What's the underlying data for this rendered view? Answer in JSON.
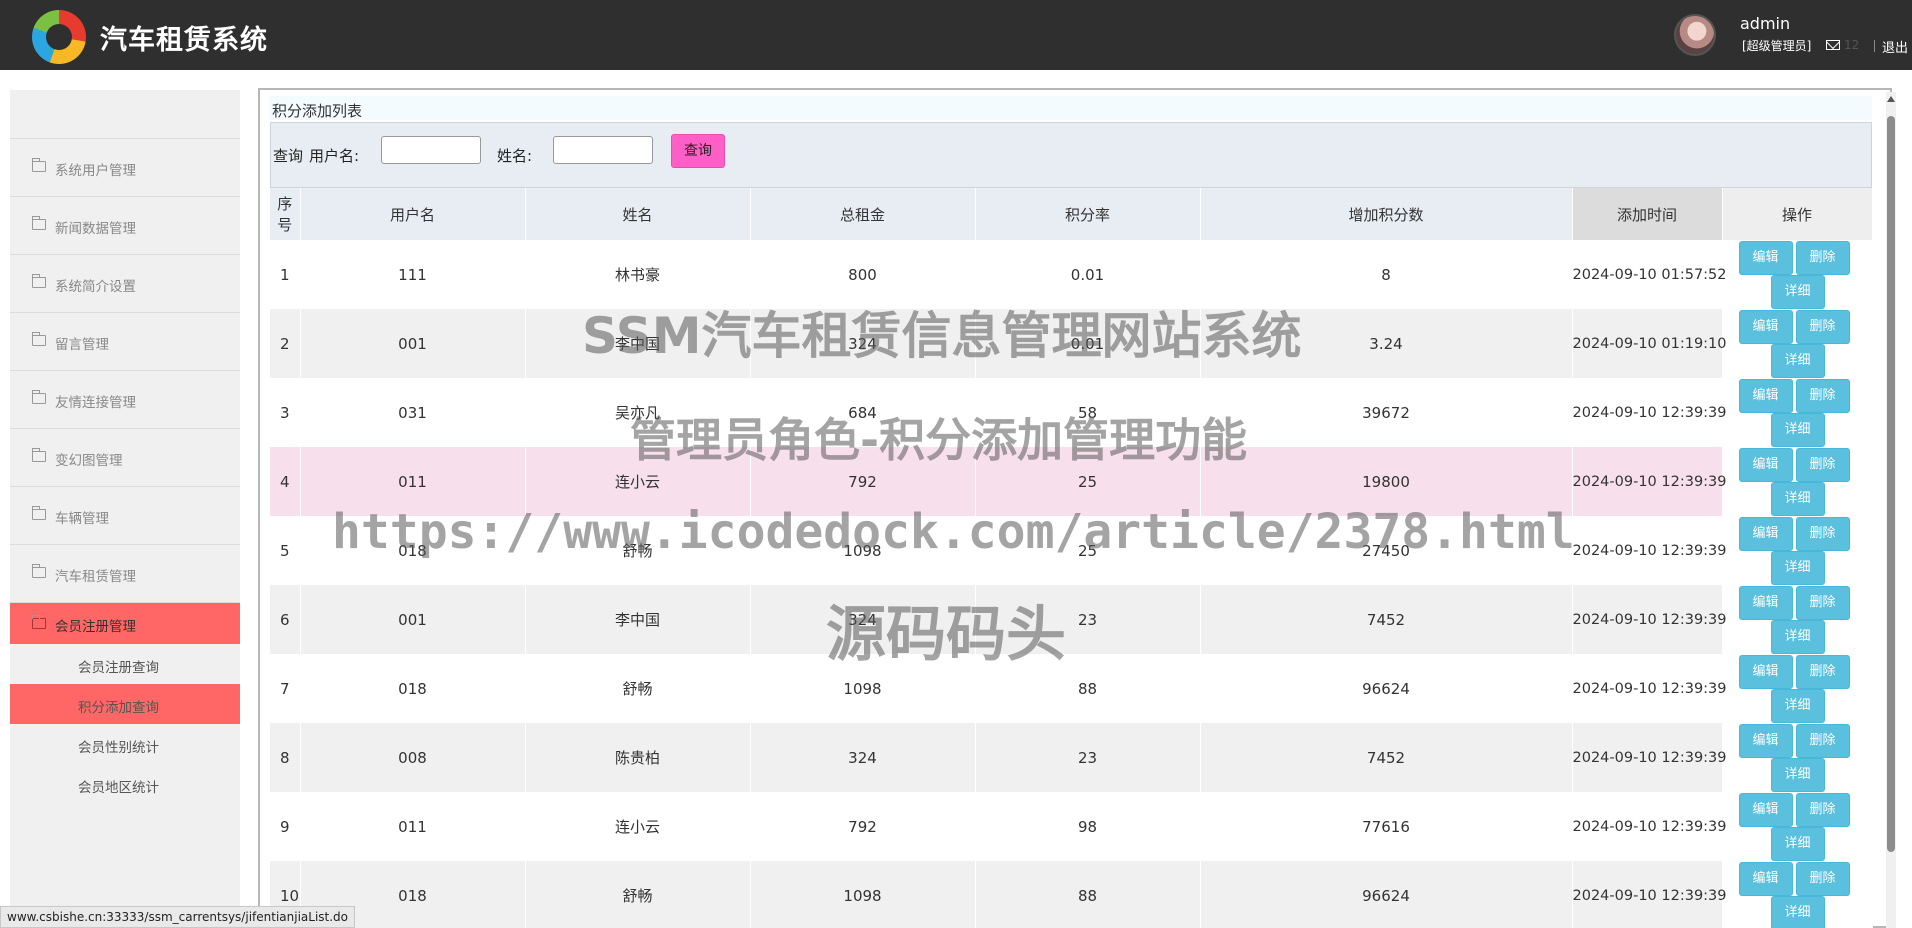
{
  "header": {
    "app_title": "汽车租赁系统",
    "user_name": "admin",
    "user_role": "[超级管理员]",
    "mail_count": "12",
    "logout": "退出"
  },
  "sidebar": {
    "items": [
      {
        "label": "系统用户管理"
      },
      {
        "label": "新闻数据管理"
      },
      {
        "label": "系统简介设置"
      },
      {
        "label": "留言管理"
      },
      {
        "label": "友情连接管理"
      },
      {
        "label": "变幻图管理"
      },
      {
        "label": "车辆管理"
      },
      {
        "label": "汽车租赁管理"
      },
      {
        "label": "会员注册管理"
      }
    ],
    "sub_items": [
      {
        "label": "会员注册查询"
      },
      {
        "label": "积分添加查询"
      },
      {
        "label": "会员性别统计"
      },
      {
        "label": "会员地区统计"
      }
    ]
  },
  "panel": {
    "title": "积分添加列表",
    "search": {
      "label_query": "查询",
      "label_username": "用户名:",
      "label_name": "姓名:",
      "username_value": "",
      "name_value": "",
      "button": "查询"
    }
  },
  "table": {
    "headers": [
      "序号",
      "用户名",
      "姓名",
      "总租金",
      "积分率",
      "增加积分数",
      "添加时间",
      "操作"
    ],
    "ops": {
      "edit": "编辑",
      "delete": "删除",
      "detail": "详细"
    },
    "rows": [
      {
        "idx": "1",
        "username": "111",
        "name": "林书豪",
        "rent": "800",
        "rate": "0.01",
        "points": "8",
        "time": "2024-09-10 01:57:52"
      },
      {
        "idx": "2",
        "username": "001",
        "name": "李中国",
        "rent": "324",
        "rate": "0.01",
        "points": "3.24",
        "time": "2024-09-10 01:19:10"
      },
      {
        "idx": "3",
        "username": "031",
        "name": "吴亦凡",
        "rent": "684",
        "rate": "58",
        "points": "39672",
        "time": "2024-09-10 12:39:39"
      },
      {
        "idx": "4",
        "username": "011",
        "name": "连小云",
        "rent": "792",
        "rate": "25",
        "points": "19800",
        "time": "2024-09-10 12:39:39"
      },
      {
        "idx": "5",
        "username": "018",
        "name": "舒畅",
        "rent": "1098",
        "rate": "25",
        "points": "27450",
        "time": "2024-09-10 12:39:39"
      },
      {
        "idx": "6",
        "username": "001",
        "name": "李中国",
        "rent": "324",
        "rate": "23",
        "points": "7452",
        "time": "2024-09-10 12:39:39"
      },
      {
        "idx": "7",
        "username": "018",
        "name": "舒畅",
        "rent": "1098",
        "rate": "88",
        "points": "96624",
        "time": "2024-09-10 12:39:39"
      },
      {
        "idx": "8",
        "username": "008",
        "name": "陈贵柏",
        "rent": "324",
        "rate": "23",
        "points": "7452",
        "time": "2024-09-10 12:39:39"
      },
      {
        "idx": "9",
        "username": "011",
        "name": "连小云",
        "rent": "792",
        "rate": "98",
        "points": "77616",
        "time": "2024-09-10 12:39:39"
      },
      {
        "idx": "10",
        "username": "018",
        "name": "舒畅",
        "rent": "1098",
        "rate": "88",
        "points": "96624",
        "time": "2024-09-10 12:39:39"
      }
    ]
  },
  "watermark": {
    "line1": "SSM汽车租赁信息管理网站系统",
    "line2": "管理员角色-积分添加管理功能",
    "line3": "https://www.icodedock.com/article/2378.html",
    "line4": "源码码头"
  },
  "status_url": "www.csbishe.cn:33333/ssm_carrentsys/jifentianjiaList.do",
  "colors": {
    "header_bg": "#2f2f2f",
    "active_menu": "#ff6666",
    "search_button": "#ff5fc7",
    "op_button": "#5bc0de",
    "highlight_row": "#f7e0ec"
  }
}
